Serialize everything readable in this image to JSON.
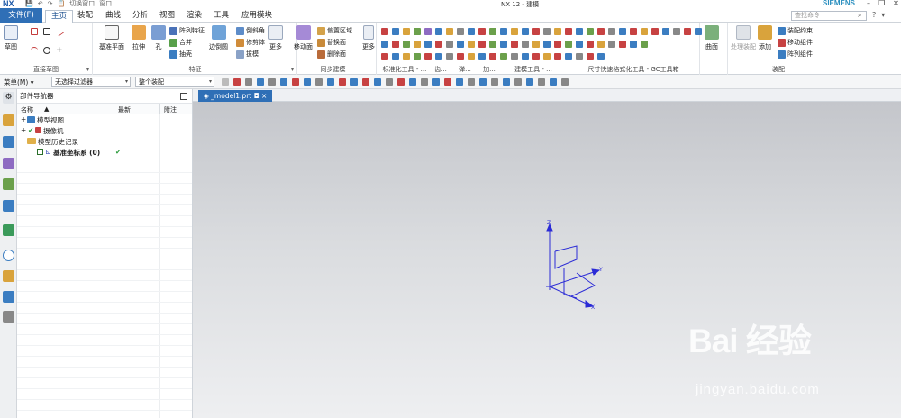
{
  "app": {
    "logo": "NX",
    "title": "NX 12 - 建模",
    "brand": "SIEMENS",
    "quick_access": [
      "💾",
      "↶",
      "↷",
      "📋",
      "切换窗口",
      "窗口"
    ],
    "window_buttons": [
      "–",
      "❐",
      "✕"
    ]
  },
  "menu_tabs": [
    {
      "label": "文件(F)",
      "state": "file"
    },
    {
      "label": "主页",
      "state": "active"
    },
    {
      "label": "装配",
      "state": ""
    },
    {
      "label": "曲线",
      "state": ""
    },
    {
      "label": "分析",
      "state": ""
    },
    {
      "label": "视图",
      "state": ""
    },
    {
      "label": "渲染",
      "state": ""
    },
    {
      "label": "工具",
      "state": ""
    },
    {
      "label": "应用模块",
      "state": ""
    }
  ],
  "search": {
    "placeholder": "查找命令"
  },
  "ribbon": {
    "sketch": {
      "big_label": "草图",
      "group_label": "直接草图"
    },
    "feature": {
      "datum_plane": "基准平面",
      "extrude": "拉伸",
      "hole": "孔",
      "pattern": "阵列特征",
      "unite": "合并",
      "shell": "抽壳",
      "group_label": "特征"
    },
    "edge": {
      "edge_blend": "边倒圆",
      "chamfer": "倒斜角",
      "trim_body": "修剪体",
      "draft": "拔模",
      "more": "更多"
    },
    "sync": {
      "move_face": "移动面",
      "offset_region": "偏置区域",
      "replace_face": "替换面",
      "delete_face": "删除面",
      "more": "更多",
      "group_label": "同步建模"
    },
    "tool_labels": [
      "标准化工具 - ...",
      "齿...",
      "弹...",
      "加...",
      "建模工具 - ...",
      "尺寸快速格式化工具 - GC工具箱"
    ],
    "surface": {
      "label": "曲面"
    },
    "assembly": {
      "process_assembly": "处理装配",
      "add": "添加",
      "constraint": "装配约束",
      "move_component": "移动组件",
      "pattern_component": "阵列组件",
      "group_label": "装配"
    }
  },
  "filter_bar": {
    "menu": "菜单(M) ▾",
    "type_filter": "无选择过滤器",
    "scope": "整个装配"
  },
  "navigator": {
    "title": "部件导航器",
    "columns": [
      "名称",
      "最新",
      "附注"
    ],
    "sort_arrow": "▲",
    "rows": [
      {
        "label": "模型视图",
        "toggle": "+",
        "latest": ""
      },
      {
        "label": "摄像机",
        "toggle": "+",
        "latest": ""
      },
      {
        "label": "模型历史记录",
        "toggle": "−",
        "latest": ""
      },
      {
        "label": "基准坐标系 (0)",
        "toggle": "",
        "latest": "✔"
      }
    ]
  },
  "document": {
    "tab_label": "_model1.prt",
    "tab_modified": "◘",
    "tab_close": "×"
  },
  "viewport": {
    "axes": {
      "x": "X",
      "y": "Y",
      "z": "Z"
    },
    "axis_color": "#2b2bd6"
  },
  "watermark": {
    "brand": "Bai 经验",
    "url": "jingyan.baidu.com"
  }
}
